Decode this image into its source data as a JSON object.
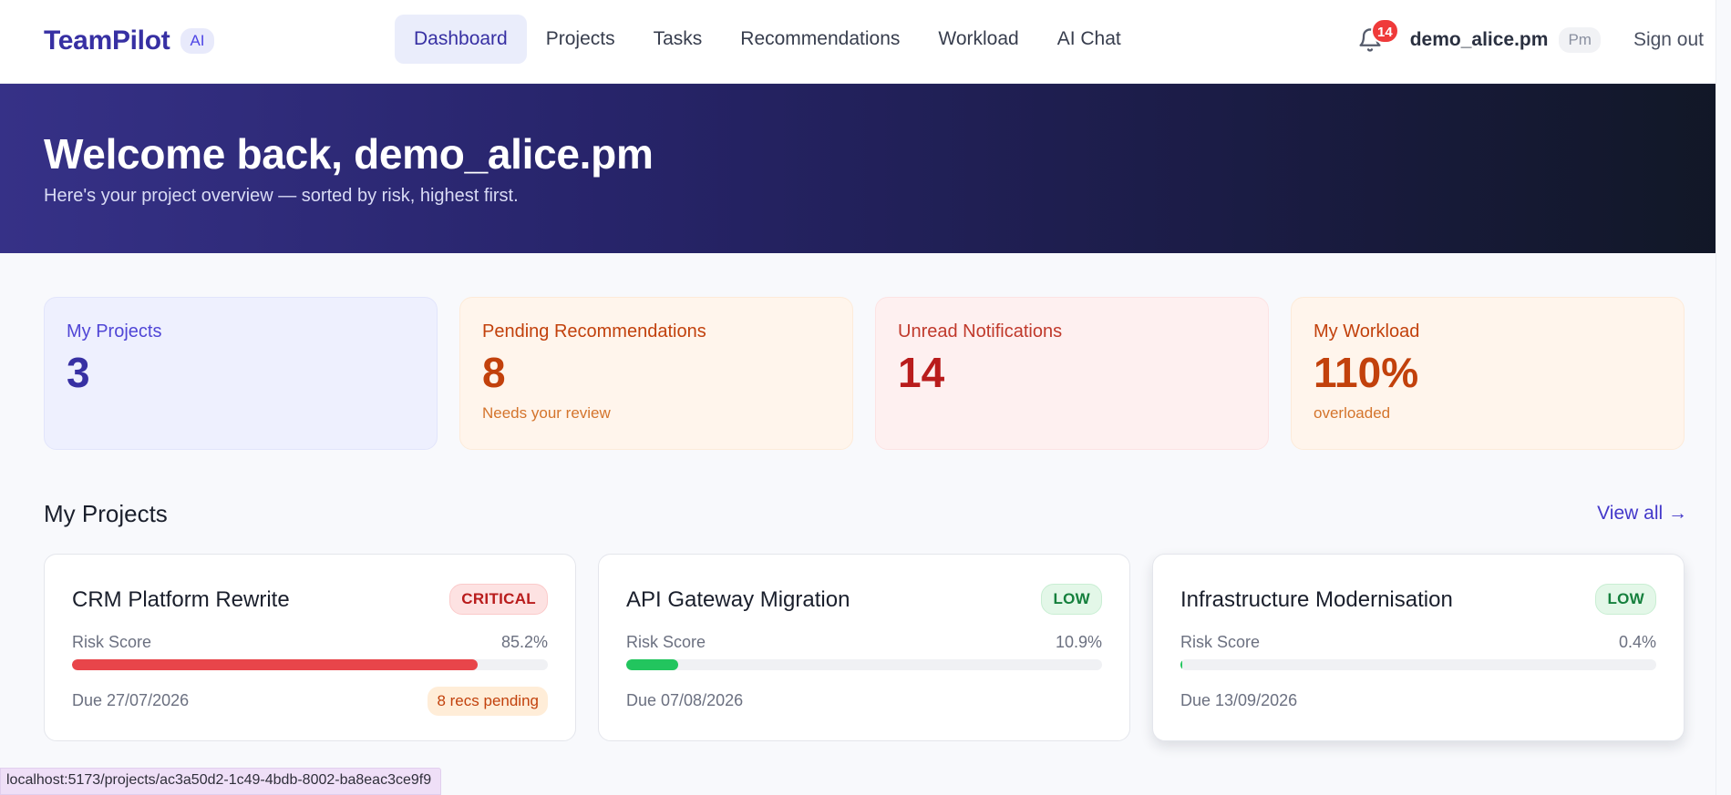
{
  "brand": {
    "name": "TeamPilot",
    "badge": "AI"
  },
  "nav": {
    "links": [
      {
        "label": "Dashboard",
        "active": true
      },
      {
        "label": "Projects",
        "active": false
      },
      {
        "label": "Tasks",
        "active": false
      },
      {
        "label": "Recommendations",
        "active": false
      },
      {
        "label": "Workload",
        "active": false
      },
      {
        "label": "AI Chat",
        "active": false
      }
    ],
    "notification_count": "14",
    "username": "demo_alice.pm",
    "role": "Pm",
    "signout_label": "Sign out",
    "icons": {
      "bell": "bell-icon"
    }
  },
  "hero": {
    "title": "Welcome back, demo_alice.pm",
    "subtitle": "Here's your project overview — sorted by risk, highest first."
  },
  "stats": [
    {
      "label": "My Projects",
      "value": "3",
      "note": "",
      "theme": "indigo"
    },
    {
      "label": "Pending Recommendations",
      "value": "8",
      "note": "Needs your review",
      "theme": "orange"
    },
    {
      "label": "Unread Notifications",
      "value": "14",
      "note": "",
      "theme": "red"
    },
    {
      "label": "My Workload",
      "value": "110%",
      "note": "overloaded",
      "theme": "orange"
    }
  ],
  "projects_section": {
    "title": "My Projects",
    "view_all_label": "View all →",
    "risk_score_label": "Risk Score",
    "items": [
      {
        "name": "CRM Platform Rewrite",
        "risk_level": "CRITICAL",
        "risk_score": "85.2%",
        "risk_value": 0.852,
        "due": "Due 27/07/2026",
        "recs": "8 recs pending"
      },
      {
        "name": "API Gateway Migration",
        "risk_level": "LOW",
        "risk_score": "10.9%",
        "risk_value": 0.109,
        "due": "Due 07/08/2026",
        "recs": ""
      },
      {
        "name": "Infrastructure Modernisation",
        "risk_level": "LOW",
        "risk_score": "0.4%",
        "risk_value": 0.004,
        "due": "Due 13/09/2026",
        "recs": ""
      }
    ]
  },
  "status_bar": {
    "url": "localhost:5173/projects/ac3a50d2-1c49-4bdb-8002-ba8eac3ce9f9"
  },
  "colors": {
    "brand": "#3730a3",
    "critical": "#e8454a",
    "low": "#22c55e",
    "warning": "#c2410c"
  }
}
